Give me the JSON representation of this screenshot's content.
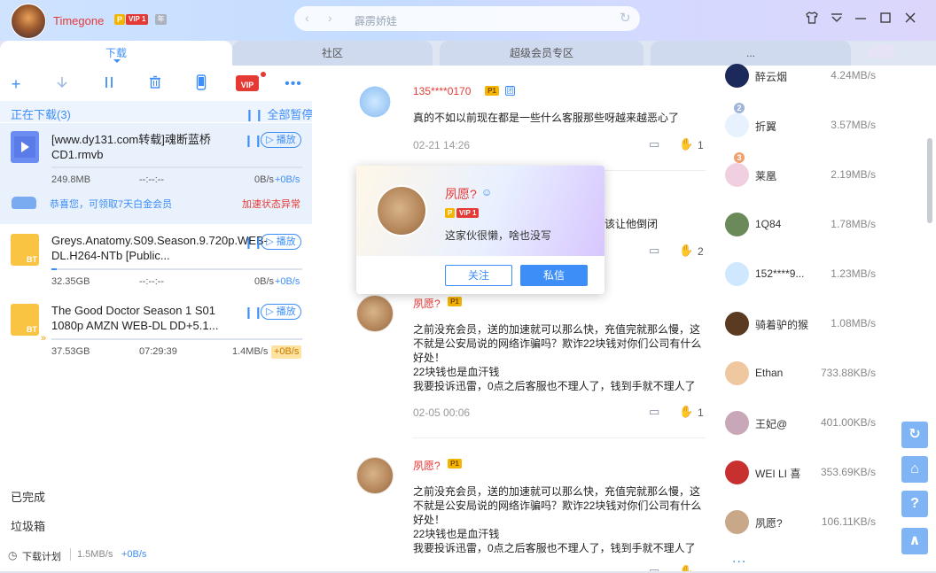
{
  "titlebar": {
    "username": "Timegone",
    "p_badge": "P",
    "vip_badge": "VIP 1",
    "year_badge": "年",
    "search_text": "霹雳娇娃",
    "icons": {
      "back": "chevron-left-icon",
      "forward": "chevron-right-icon",
      "refresh": "refresh-icon",
      "skin": "tshirt-icon",
      "menu": "menu-icon",
      "minimize": "minimize-icon",
      "maximize": "maximize-icon",
      "close": "close-icon"
    }
  },
  "tabs": [
    "下载",
    "社区",
    "超级会员专区",
    "..."
  ],
  "toolbar": {
    "icons": [
      "plus-icon",
      "download-icon",
      "pause-icon",
      "trash-icon",
      "phone-icon",
      "vip-icon",
      "more-icon"
    ],
    "vip_label": "VIP"
  },
  "downloading": {
    "title": "正在下载(3)",
    "pause_all": "全部暂停"
  },
  "tasks": [
    {
      "name": "[www.dy131.com转载]魂断蓝桥CD1.rmvb",
      "size": "249.8MB",
      "time": "--:--:--",
      "speed": "0B/s",
      "boost": "+0B/s",
      "play": "播放",
      "progress": 0.0,
      "icon_label": ""
    },
    {
      "name": "Greys.Anatomy.S09.Season.9.720p.WEB-DL.H264-NTb [Public...",
      "size": "32.35GB",
      "time": "--:--:--",
      "speed": "0B/s",
      "boost": "+0B/s",
      "play": "播放",
      "progress": 0.01,
      "icon_label": "BT"
    },
    {
      "name": "The Good Doctor Season 1 S01 1080p AMZN WEB-DL DD+5.1...",
      "size": "37.53GB",
      "time": "07:29:39",
      "speed": "1.4MB/s",
      "boost": "+0B/s",
      "play": "播放",
      "progress": 0.0,
      "icon_label": "BT"
    }
  ],
  "promo": {
    "text": "恭喜您，可领取7天白金会员",
    "status": "加速状态异常"
  },
  "sidebar": {
    "completed": "已完成",
    "trash": "垃圾箱"
  },
  "footer": {
    "plan": "下载计划",
    "speed": "1.5MB/s",
    "boost": "+0B/s"
  },
  "comments": [
    {
      "name": "135****0170",
      "p": "P1",
      "group": "团",
      "text": "真的不如以前现在都是一些什么客服那些呀越来越恶心了",
      "time": "02-21 14:26",
      "likes": "1"
    },
    {
      "name": "",
      "p": "",
      "group": "",
      "text": "该让他倒闭",
      "time": "",
      "likes": "2"
    },
    {
      "name": "夙愿?",
      "p": "P1",
      "group": "",
      "text": "之前没充会员，送的加速就可以那么快，充值完就那么慢，这不就是公安局说的网络诈骗吗？欺诈22块钱对你们公司有什么好处！\n22块钱也是血汗钱\n我要投诉迅雷，0点之后客服也不理人了，钱到手就不理人了",
      "time": "02-05 00:06",
      "likes": "1"
    },
    {
      "name": "夙愿?",
      "p": "P1",
      "group": "",
      "text": "之前没充会员，送的加速就可以那么快，充值完就那么慢，这不就是公安局说的网络诈骗吗？欺诈22块钱对你们公司有什么好处！\n22块钱也是血汗钱\n我要投诉迅雷，0点之后客服也不理人了，钱到手就不理人了",
      "time": "",
      "likes": ""
    }
  ],
  "popup": {
    "name": "夙愿?",
    "p": "P",
    "vip": "VIP 1",
    "bio": "这家伙很懒，啥也没写",
    "follow": "关注",
    "message": "私信"
  },
  "ranking": [
    {
      "name": "醉云烟",
      "speed": "4.24MB/s",
      "rank": ""
    },
    {
      "name": "折翼",
      "speed": "3.57MB/s",
      "rank": "2"
    },
    {
      "name": "莱凰",
      "speed": "2.19MB/s",
      "rank": "3"
    },
    {
      "name": "1Q84",
      "speed": "1.78MB/s",
      "rank": ""
    },
    {
      "name": "152****9...",
      "speed": "1.23MB/s",
      "rank": ""
    },
    {
      "name": "骑着驴的猴",
      "speed": "1.08MB/s",
      "rank": ""
    },
    {
      "name": "Ethan",
      "speed": "733.88KB/s",
      "rank": ""
    },
    {
      "name": "王妃@",
      "speed": "401.00KB/s",
      "rank": ""
    },
    {
      "name": "WEI LI 喜",
      "speed": "353.69KB/s",
      "rank": ""
    },
    {
      "name": "夙愿?",
      "speed": "106.11KB/s",
      "rank": ""
    }
  ],
  "ranking_more": "...",
  "side_buttons": [
    "refresh-icon",
    "home-icon",
    "help-icon",
    "back-to-top-icon"
  ],
  "colors": {
    "accent": "#3d8ef7",
    "vip_red": "#e53935",
    "gold": "#f5b400"
  }
}
